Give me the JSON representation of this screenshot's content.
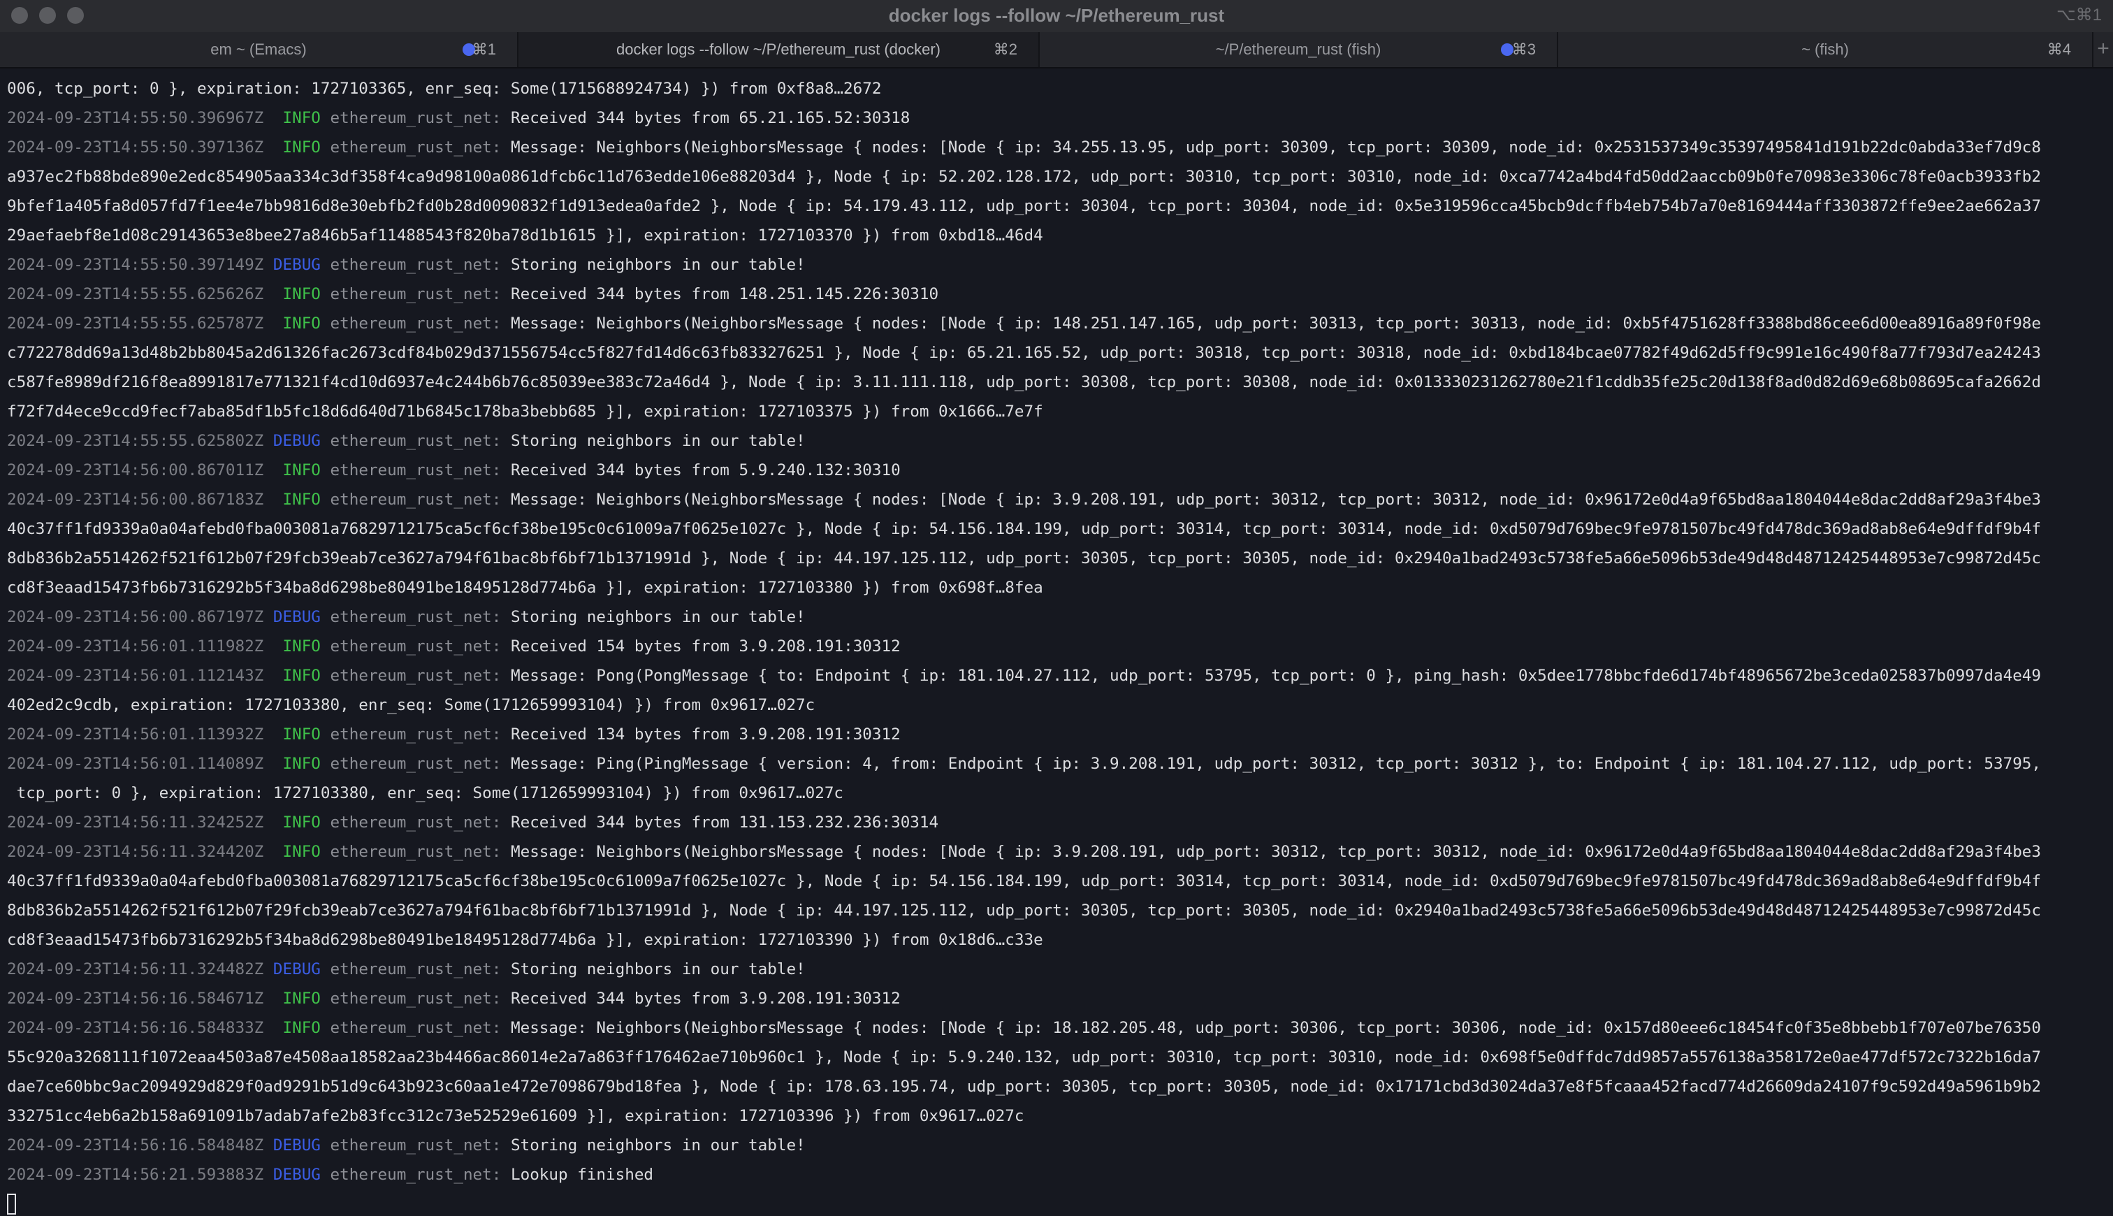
{
  "window": {
    "title": "docker logs --follow ~/P/ethereum_rust",
    "shortcut": "⌥⌘1"
  },
  "tabs": [
    {
      "label": "em ~ (Emacs)",
      "key": "⌘1",
      "dot": true,
      "active": false
    },
    {
      "label": "docker logs --follow ~/P/ethereum_rust (docker)",
      "key": "⌘2",
      "dot": false,
      "active": true
    },
    {
      "label": "~/P/ethereum_rust (fish)",
      "key": "⌘3",
      "dot": true,
      "active": false
    },
    {
      "label": "~ (fish)",
      "key": "⌘4",
      "dot": false,
      "active": false
    }
  ],
  "new_tab_label": "+",
  "colors": {
    "info": "#3fc14a",
    "debug": "#3b5ee6",
    "tab_dot": "#4a67f0",
    "background": "#161820"
  },
  "lines": [
    {
      "cont": "006, tcp_port: 0 }, expiration: 1727103365, enr_seq: Some(1715688924734) }) from 0xf8a8…2672"
    },
    {
      "ts": "2024-09-23T14:55:50.396967Z",
      "level": "INFO",
      "module": "ethereum_rust_net:",
      "msg": "Received 344 bytes from 65.21.165.52:30318"
    },
    {
      "ts": "2024-09-23T14:55:50.397136Z",
      "level": "INFO",
      "module": "ethereum_rust_net:",
      "msg": "Message: Neighbors(NeighborsMessage { nodes: [Node { ip: 34.255.13.95, udp_port: 30309, tcp_port: 30309, node_id: 0x2531537349c35397495841d191b22dc0abda33ef7d9c8"
    },
    {
      "cont": "a937ec2fb88bde890e2edc854905aa334c3df358f4ca9d98100a0861dfcb6c11d763edde106e88203d4 }, Node { ip: 52.202.128.172, udp_port: 30310, tcp_port: 30310, node_id: 0xca7742a4bd4fd50dd2aaccb09b0fe70983e3306c78fe0acb3933fb2"
    },
    {
      "cont": "9bfef1a405fa8d057fd7f1ee4e7bb9816d8e30ebfb2fd0b28d0090832f1d913edea0afde2 }, Node { ip: 54.179.43.112, udp_port: 30304, tcp_port: 30304, node_id: 0x5e319596cca45bcb9dcffb4eb754b7a70e8169444aff3303872ffe9ee2ae662a37"
    },
    {
      "cont": "29aefaebf8e1d08c29143653e8bee27a846b5af11488543f820ba78d1b1615 }], expiration: 1727103370 }) from 0xbd18…46d4"
    },
    {
      "ts": "2024-09-23T14:55:50.397149Z",
      "level": "DEBUG",
      "module": "ethereum_rust_net:",
      "msg": "Storing neighbors in our table!"
    },
    {
      "ts": "2024-09-23T14:55:55.625626Z",
      "level": "INFO",
      "module": "ethereum_rust_net:",
      "msg": "Received 344 bytes from 148.251.145.226:30310"
    },
    {
      "ts": "2024-09-23T14:55:55.625787Z",
      "level": "INFO",
      "module": "ethereum_rust_net:",
      "msg": "Message: Neighbors(NeighborsMessage { nodes: [Node { ip: 148.251.147.165, udp_port: 30313, tcp_port: 30313, node_id: 0xb5f4751628ff3388bd86cee6d00ea8916a89f0f98e"
    },
    {
      "cont": "c772278dd69a13d48b2bb8045a2d61326fac2673cdf84b029d371556754cc5f827fd14d6c63fb833276251 }, Node { ip: 65.21.165.52, udp_port: 30318, tcp_port: 30318, node_id: 0xbd184bcae07782f49d62d5ff9c991e16c490f8a77f793d7ea24243"
    },
    {
      "cont": "c587fe8989df216f8ea8991817e771321f4cd10d6937e4c244b6b76c85039ee383c72a46d4 }, Node { ip: 3.11.111.118, udp_port: 30308, tcp_port: 30308, node_id: 0x013330231262780e21f1cddb35fe25c20d138f8ad0d82d69e68b08695cafa2662d"
    },
    {
      "cont": "f72f7d4ece9ccd9fecf7aba85df1b5fc18d6d640d71b6845c178ba3bebb685 }], expiration: 1727103375 }) from 0x1666…7e7f"
    },
    {
      "ts": "2024-09-23T14:55:55.625802Z",
      "level": "DEBUG",
      "module": "ethereum_rust_net:",
      "msg": "Storing neighbors in our table!"
    },
    {
      "ts": "2024-09-23T14:56:00.867011Z",
      "level": "INFO",
      "module": "ethereum_rust_net:",
      "msg": "Received 344 bytes from 5.9.240.132:30310"
    },
    {
      "ts": "2024-09-23T14:56:00.867183Z",
      "level": "INFO",
      "module": "ethereum_rust_net:",
      "msg": "Message: Neighbors(NeighborsMessage { nodes: [Node { ip: 3.9.208.191, udp_port: 30312, tcp_port: 30312, node_id: 0x96172e0d4a9f65bd8aa1804044e8dac2dd8af29a3f4be3"
    },
    {
      "cont": "40c37ff1fd9339a0a04afebd0fba003081a76829712175ca5cf6cf38be195c0c61009a7f0625e1027c }, Node { ip: 54.156.184.199, udp_port: 30314, tcp_port: 30314, node_id: 0xd5079d769bec9fe9781507bc49fd478dc369ad8ab8e64e9dffdf9b4f"
    },
    {
      "cont": "8db836b2a5514262f521f612b07f29fcb39eab7ce3627a794f61bac8bf6bf71b1371991d }, Node { ip: 44.197.125.112, udp_port: 30305, tcp_port: 30305, node_id: 0x2940a1bad2493c5738fe5a66e5096b53de49d48d48712425448953e7c99872d45c"
    },
    {
      "cont": "cd8f3eaad15473fb6b7316292b5f34ba8d6298be80491be18495128d774b6a }], expiration: 1727103380 }) from 0x698f…8fea"
    },
    {
      "ts": "2024-09-23T14:56:00.867197Z",
      "level": "DEBUG",
      "module": "ethereum_rust_net:",
      "msg": "Storing neighbors in our table!"
    },
    {
      "ts": "2024-09-23T14:56:01.111982Z",
      "level": "INFO",
      "module": "ethereum_rust_net:",
      "msg": "Received 154 bytes from 3.9.208.191:30312"
    },
    {
      "ts": "2024-09-23T14:56:01.112143Z",
      "level": "INFO",
      "module": "ethereum_rust_net:",
      "msg": "Message: Pong(PongMessage { to: Endpoint { ip: 181.104.27.112, udp_port: 53795, tcp_port: 0 }, ping_hash: 0x5dee1778bbcfde6d174bf48965672be3ceda025837b0997da4e49"
    },
    {
      "cont": "402ed2c9cdb, expiration: 1727103380, enr_seq: Some(1712659993104) }) from 0x9617…027c"
    },
    {
      "ts": "2024-09-23T14:56:01.113932Z",
      "level": "INFO",
      "module": "ethereum_rust_net:",
      "msg": "Received 134 bytes from 3.9.208.191:30312"
    },
    {
      "ts": "2024-09-23T14:56:01.114089Z",
      "level": "INFO",
      "module": "ethereum_rust_net:",
      "msg": "Message: Ping(PingMessage { version: 4, from: Endpoint { ip: 3.9.208.191, udp_port: 30312, tcp_port: 30312 }, to: Endpoint { ip: 181.104.27.112, udp_port: 53795,"
    },
    {
      "cont": " tcp_port: 0 }, expiration: 1727103380, enr_seq: Some(1712659993104) }) from 0x9617…027c"
    },
    {
      "ts": "2024-09-23T14:56:11.324252Z",
      "level": "INFO",
      "module": "ethereum_rust_net:",
      "msg": "Received 344 bytes from 131.153.232.236:30314"
    },
    {
      "ts": "2024-09-23T14:56:11.324420Z",
      "level": "INFO",
      "module": "ethereum_rust_net:",
      "msg": "Message: Neighbors(NeighborsMessage { nodes: [Node { ip: 3.9.208.191, udp_port: 30312, tcp_port: 30312, node_id: 0x96172e0d4a9f65bd8aa1804044e8dac2dd8af29a3f4be3"
    },
    {
      "cont": "40c37ff1fd9339a0a04afebd0fba003081a76829712175ca5cf6cf38be195c0c61009a7f0625e1027c }, Node { ip: 54.156.184.199, udp_port: 30314, tcp_port: 30314, node_id: 0xd5079d769bec9fe9781507bc49fd478dc369ad8ab8e64e9dffdf9b4f"
    },
    {
      "cont": "8db836b2a5514262f521f612b07f29fcb39eab7ce3627a794f61bac8bf6bf71b1371991d }, Node { ip: 44.197.125.112, udp_port: 30305, tcp_port: 30305, node_id: 0x2940a1bad2493c5738fe5a66e5096b53de49d48d48712425448953e7c99872d45c"
    },
    {
      "cont": "cd8f3eaad15473fb6b7316292b5f34ba8d6298be80491be18495128d774b6a }], expiration: 1727103390 }) from 0x18d6…c33e"
    },
    {
      "ts": "2024-09-23T14:56:11.324482Z",
      "level": "DEBUG",
      "module": "ethereum_rust_net:",
      "msg": "Storing neighbors in our table!"
    },
    {
      "ts": "2024-09-23T14:56:16.584671Z",
      "level": "INFO",
      "module": "ethereum_rust_net:",
      "msg": "Received 344 bytes from 3.9.208.191:30312"
    },
    {
      "ts": "2024-09-23T14:56:16.584833Z",
      "level": "INFO",
      "module": "ethereum_rust_net:",
      "msg": "Message: Neighbors(NeighborsMessage { nodes: [Node { ip: 18.182.205.48, udp_port: 30306, tcp_port: 30306, node_id: 0x157d80eee6c18454fc0f35e8bbebb1f707e07be76350"
    },
    {
      "cont": "55c920a3268111f1072eaa4503a87e4508aa18582aa23b4466ac86014e2a7a863ff176462ae710b960c1 }, Node { ip: 5.9.240.132, udp_port: 30310, tcp_port: 30310, node_id: 0x698f5e0dffdc7dd9857a5576138a358172e0ae477df572c7322b16da7"
    },
    {
      "cont": "dae7ce60bbc9ac2094929d829f0ad9291b51d9c643b923c60aa1e472e7098679bd18fea }, Node { ip: 178.63.195.74, udp_port: 30305, tcp_port: 30305, node_id: 0x17171cbd3d3024da37e8f5fcaaa452facd774d26609da24107f9c592d49a5961b9b2"
    },
    {
      "cont": "332751cc4eb6a2b158a691091b7adab7afe2b83fcc312c73e52529e61609 }], expiration: 1727103396 }) from 0x9617…027c"
    },
    {
      "ts": "2024-09-23T14:56:16.584848Z",
      "level": "DEBUG",
      "module": "ethereum_rust_net:",
      "msg": "Storing neighbors in our table!"
    },
    {
      "ts": "2024-09-23T14:56:21.593883Z",
      "level": "DEBUG",
      "module": "ethereum_rust_net:",
      "msg": "Lookup finished"
    }
  ]
}
